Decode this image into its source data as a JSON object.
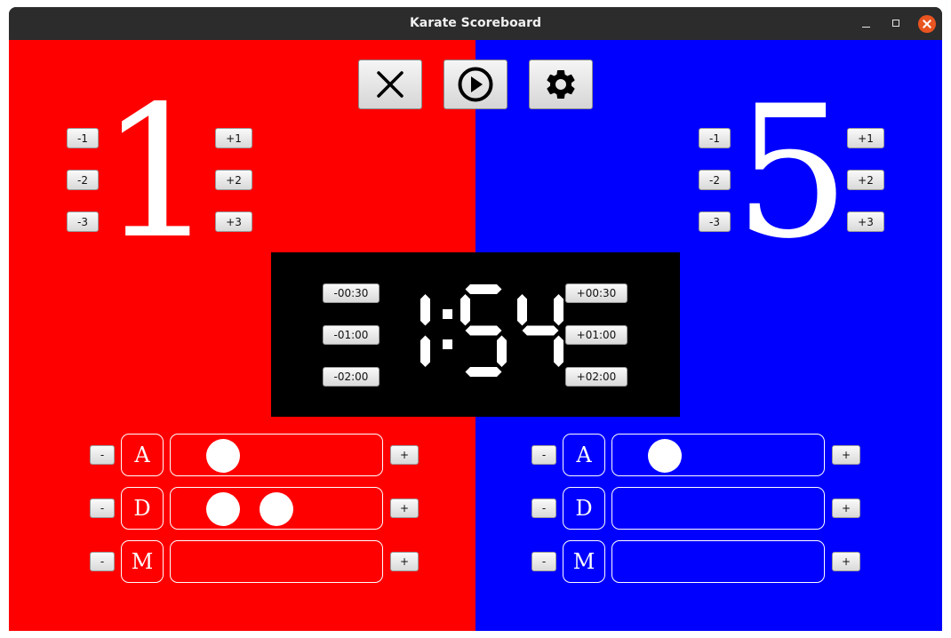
{
  "window": {
    "title": "Karate Scoreboard"
  },
  "colors": {
    "red_side": "#ff0000",
    "blue_side": "#0000ff",
    "timer_bg": "#000000",
    "digits": "#ffffff"
  },
  "toolbar": {
    "icons": [
      "close-icon",
      "play-icon",
      "gear-icon"
    ]
  },
  "red": {
    "score": "1",
    "minus": [
      "-1",
      "-2",
      "-3"
    ],
    "plus": [
      "+1",
      "+2",
      "+3"
    ],
    "rows": [
      {
        "letter": "A",
        "dots": 1
      },
      {
        "letter": "D",
        "dots": 2
      },
      {
        "letter": "M",
        "dots": 0
      }
    ],
    "row_minus": "-",
    "row_plus": "+"
  },
  "blue": {
    "score": "5",
    "minus": [
      "-1",
      "-2",
      "-3"
    ],
    "plus": [
      "+1",
      "+2",
      "+3"
    ],
    "rows": [
      {
        "letter": "A",
        "dots": 1
      },
      {
        "letter": "D",
        "dots": 0
      },
      {
        "letter": "M",
        "dots": 0
      }
    ],
    "row_minus": "-",
    "row_plus": "+"
  },
  "timer": {
    "display": "1:54",
    "minus": [
      "-00:30",
      "-01:00",
      "-02:00"
    ],
    "plus": [
      "+00:30",
      "+01:00",
      "+02:00"
    ]
  }
}
